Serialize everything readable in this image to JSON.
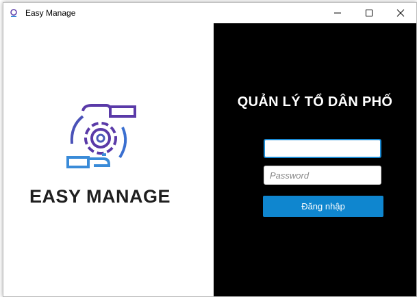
{
  "window": {
    "title": "Easy Manage"
  },
  "left": {
    "brand_text": "EASY MANAGE"
  },
  "login": {
    "heading": "QUẢN LÝ TỔ DÂN PHỐ",
    "username_value": "",
    "username_placeholder": "",
    "password_placeholder": "Password",
    "submit_label": "Đăng nhập"
  },
  "colors": {
    "panel_dark": "#000000",
    "accent": "#0f86cf",
    "logo_primary": "#5a3aa8",
    "logo_secondary": "#3a8bd8"
  },
  "icons": {
    "app": "app-logo-icon",
    "minimize": "minimize-icon",
    "maximize": "maximize-icon",
    "close": "close-icon",
    "logo": "gear-hands-logo-icon"
  }
}
